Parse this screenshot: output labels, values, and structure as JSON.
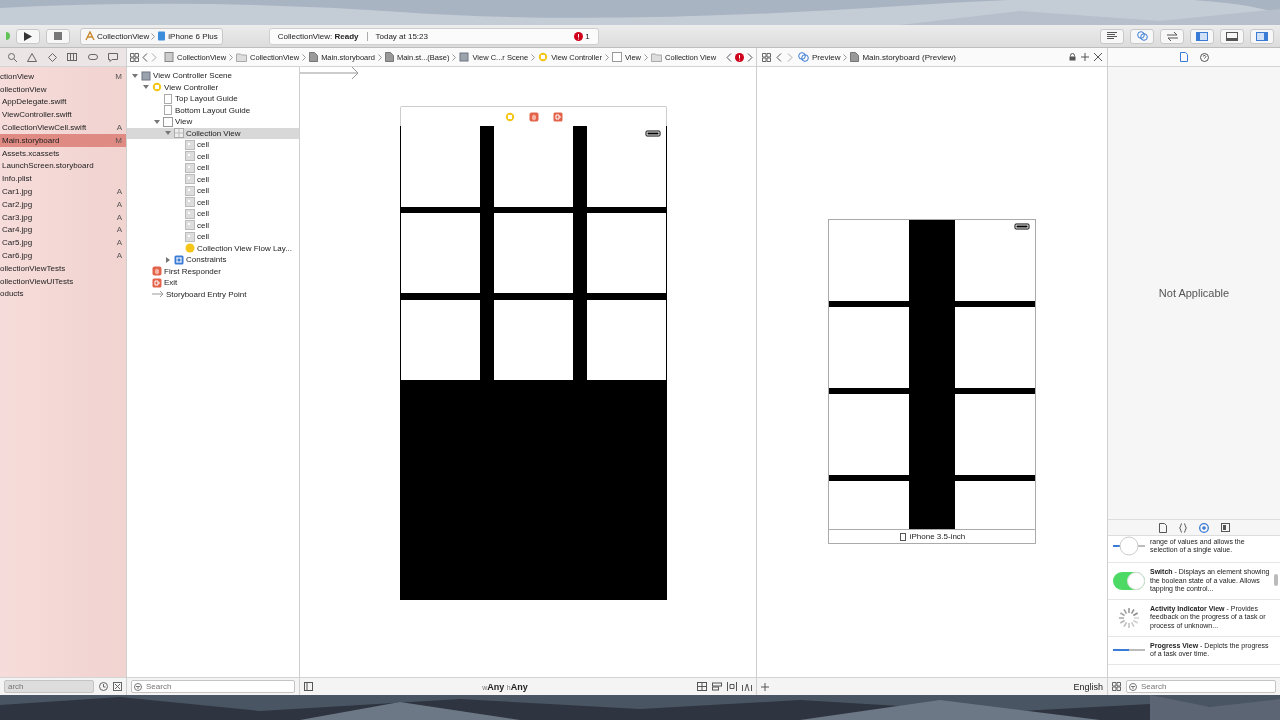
{
  "toolbar": {
    "scheme": "CollectionView",
    "device": "iPhone 6 Plus",
    "status": "CollectionView: **Ready**",
    "time": "Today at 15:23",
    "errors": "1",
    "panels": [
      {
        "kind": "navigator",
        "selected": true
      },
      {
        "kind": "debug",
        "selected": false
      },
      {
        "kind": "utilities",
        "selected": true
      }
    ]
  },
  "navigator": {
    "items": [
      {
        "name": "ctionView",
        "badge": "M",
        "selected": false,
        "children": [
          {
            "name": "ollectionView",
            "selected": false,
            "children": [
              {
                "name": "AppDelegate.swift",
                "selected": false
              },
              {
                "name": "ViewController.swift",
                "selected": false
              },
              {
                "name": "CollectionViewCell.swift",
                "badge": "A",
                "selected": false
              },
              {
                "name": "Main.storyboard",
                "badge": "M",
                "selected": true
              },
              {
                "name": "Assets.xcassets",
                "selected": false
              },
              {
                "name": "LaunchScreen.storyboard",
                "selected": false
              },
              {
                "name": "Info.plist",
                "selected": false
              },
              {
                "name": "Car1.jpg",
                "badge": "A",
                "selected": false
              },
              {
                "name": "Car2.jpg",
                "badge": "A",
                "selected": false
              },
              {
                "name": "Car3.jpg",
                "badge": "A",
                "selected": false
              },
              {
                "name": "Car4.jpg",
                "badge": "A",
                "selected": false
              },
              {
                "name": "Car5.jpg",
                "badge": "A",
                "selected": false
              },
              {
                "name": "Car6.jpg",
                "badge": "A",
                "selected": false
              }
            ]
          },
          {
            "name": "ollectionViewTests",
            "selected": false
          },
          {
            "name": "ollectionViewUITests",
            "selected": false
          },
          {
            "name": "oducts",
            "selected": false
          }
        ]
      }
    ],
    "filter_placeholder": "arch"
  },
  "outline": {
    "nodes": [
      {
        "label": "View Controller Scene",
        "kind": "scene",
        "expanded": true,
        "selected": false,
        "children": [
          {
            "label": "View Controller",
            "kind": "controller",
            "expanded": true,
            "selected": false,
            "children": [
              {
                "label": "Top Layout Guide",
                "kind": "guide",
                "selected": false
              },
              {
                "label": "Bottom Layout Guide",
                "kind": "guide",
                "selected": false
              },
              {
                "label": "View",
                "kind": "view",
                "expanded": true,
                "selected": false,
                "children": [
                  {
                    "label": "Collection View",
                    "kind": "collection",
                    "expanded": true,
                    "selected": true,
                    "children": [
                      {
                        "label": "cell",
                        "kind": "cell",
                        "selected": false
                      },
                      {
                        "label": "cell",
                        "kind": "cell",
                        "selected": false
                      },
                      {
                        "label": "cell",
                        "kind": "cell",
                        "selected": false
                      },
                      {
                        "label": "cell",
                        "kind": "cell",
                        "selected": false
                      },
                      {
                        "label": "cell",
                        "kind": "cell",
                        "selected": false
                      },
                      {
                        "label": "cell",
                        "kind": "cell",
                        "selected": false
                      },
                      {
                        "label": "cell",
                        "kind": "cell",
                        "selected": false
                      },
                      {
                        "label": "cell",
                        "kind": "cell",
                        "selected": false
                      },
                      {
                        "label": "cell",
                        "kind": "cell",
                        "selected": false
                      },
                      {
                        "label": "Collection View Flow Lay...",
                        "kind": "flow",
                        "selected": false
                      }
                    ]
                  },
                  {
                    "label": "Constraints",
                    "kind": "constraints",
                    "expanded": false,
                    "selected": false
                  }
                ]
              }
            ]
          },
          {
            "label": "First Responder",
            "kind": "responder",
            "selected": false
          },
          {
            "label": "Exit",
            "kind": "exit",
            "selected": false
          },
          {
            "label": "Storyboard Entry Point",
            "kind": "entry",
            "selected": false
          }
        ]
      }
    ],
    "filter_placeholder": "Search"
  },
  "editor": {
    "jump_bar": [
      {
        "label": "CollectionView",
        "kind": "project"
      },
      {
        "label": "CollectionView",
        "kind": "folder"
      },
      {
        "label": "Main.storyboard",
        "kind": "file"
      },
      {
        "label": "Main.st...(Base)",
        "kind": "file"
      },
      {
        "label": "View C...r Scene",
        "kind": "scene"
      },
      {
        "label": "View Controller",
        "kind": "controller"
      },
      {
        "label": "View",
        "kind": "view"
      },
      {
        "label": "Collection View",
        "kind": "folder"
      }
    ],
    "size_class": [
      {
        "prefix": "w",
        "value": "Any"
      },
      {
        "prefix": "h",
        "value": "Any"
      }
    ]
  },
  "preview": {
    "jump_bar": [
      {
        "label": "Preview",
        "kind": "preview"
      },
      {
        "label": "Main.storyboard (Preview)",
        "kind": "file"
      }
    ],
    "device": "iPhone 3.5-inch",
    "language": "English"
  },
  "inspector": {
    "message": "Not Applicable"
  },
  "library": {
    "items": [
      {
        "kind": "slider",
        "text": "range of values and allows the selection of a single value."
      },
      {
        "kind": "switch",
        "text": "**Switch** - Displays an element showing the boolean state of a value. Allows tapping the control..."
      },
      {
        "kind": "activity",
        "text": "**Activity Indicator View** - Provides feedback on the progress of a task or process of unknown..."
      },
      {
        "kind": "progress",
        "text": "**Progress View** - Depicts the progress of a task over time."
      }
    ],
    "filter_placeholder": "Search"
  }
}
